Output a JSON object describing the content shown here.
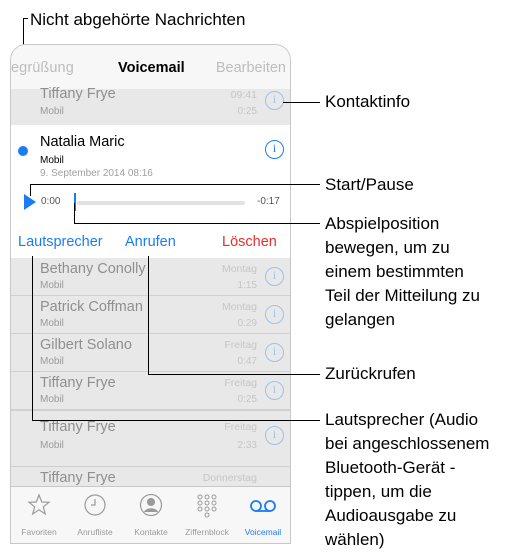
{
  "callouts": {
    "unheard": "Nicht abgehörte Nachrichten",
    "contact_info": "Kontaktinfo",
    "start_pause": "Start/Pause",
    "seek": [
      "Abspielposition",
      "bewegen, um zu",
      "einem bestimmten",
      "Teil der Mitteilung zu",
      "gelangen"
    ],
    "call_back": "Zurückrufen",
    "speaker": [
      "Lautsprecher (Audio",
      "bei angeschlossenem",
      "Bluetooth-Gerät -",
      "tippen, um die",
      "Audioausgabe zu",
      "wählen)"
    ]
  },
  "nav": {
    "left": "egrüßung",
    "title": "Voicemail",
    "right": "Bearbeiten"
  },
  "first_row": {
    "name": "Tiffany Frye",
    "sub": "Mobil",
    "time": "09:41",
    "duration": "0:25"
  },
  "expanded": {
    "name": "Natalia Maric",
    "sub": "Mobil",
    "date": "9. September 2014  08:16",
    "current": "0:00",
    "remaining": "-0:17",
    "speaker_label": "Lautsprecher",
    "call_label": "Anrufen",
    "delete_label": "Löschen"
  },
  "rows": [
    {
      "name": "Bethany Conolly",
      "sub": "Mobil",
      "time": "Montag",
      "duration": "1:15"
    },
    {
      "name": "Patrick Coffman",
      "sub": "Mobil",
      "time": "Montag",
      "duration": "0:29"
    },
    {
      "name": "Gilbert Solano",
      "sub": "Mobil",
      "time": "Freitag",
      "duration": "0:47"
    },
    {
      "name": "Tiffany Frye",
      "sub": "Mobil",
      "time": "Freitag",
      "duration": "0:25"
    },
    {
      "name": "Tiffany Frye",
      "sub": "Mobil",
      "time": "Freitag",
      "duration": "2:33"
    },
    {
      "name": "Tiffany Frye",
      "sub": "Mobil",
      "time": "Donnerstag",
      "duration": ""
    }
  ],
  "info_glyph": "i",
  "tabs": [
    {
      "label": "Favoriten",
      "icon": "star-icon"
    },
    {
      "label": "Anrufliste",
      "icon": "clock-icon"
    },
    {
      "label": "Kontakte",
      "icon": "person-icon"
    },
    {
      "label": "Ziffernblock",
      "icon": "keypad-icon"
    },
    {
      "label": "Voicemail",
      "icon": "voicemail-icon"
    }
  ],
  "colors": {
    "accent": "#1a7cf5",
    "delete": "#e8302a",
    "dim_row": "#e8e8e8"
  }
}
